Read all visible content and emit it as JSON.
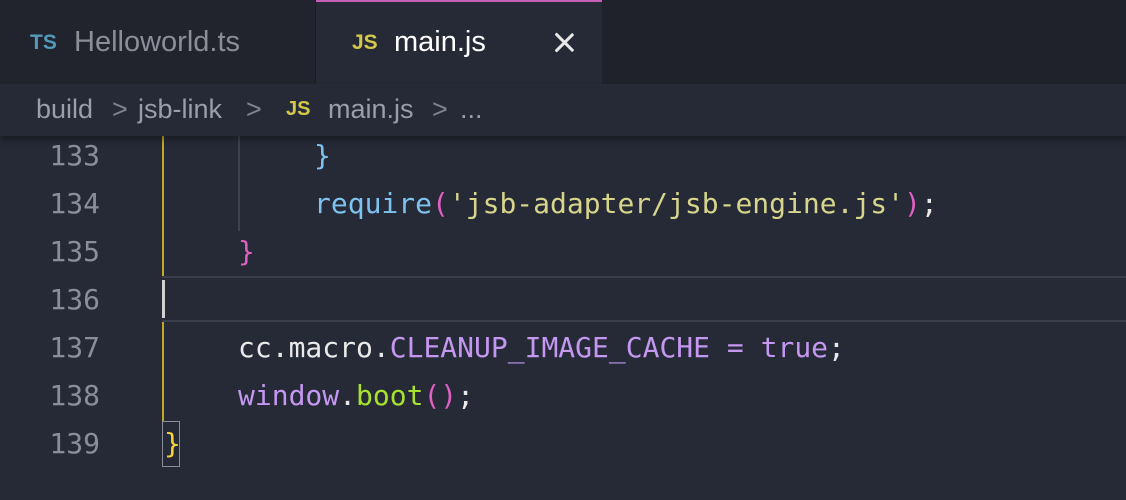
{
  "tabs": [
    {
      "icon": "TS",
      "label": "Helloworld.ts",
      "active": false
    },
    {
      "icon": "JS",
      "label": "main.js",
      "active": true
    }
  ],
  "breadcrumb": {
    "items": [
      "build",
      "jsb-link",
      "main.js",
      "..."
    ],
    "file_icon": "JS",
    "separator": ">"
  },
  "editor": {
    "line_numbers": [
      "133",
      "134",
      "135",
      "136",
      "137",
      "138",
      "139"
    ],
    "lines": {
      "l133": {
        "brace": "}"
      },
      "l134": {
        "func": "require",
        "open": "(",
        "str": "'jsb-adapter/jsb-engine.js'",
        "close": ")",
        "semi": ";"
      },
      "l135": {
        "brace": "}"
      },
      "l137": {
        "obj": "cc",
        "dot1": ".",
        "prop": "macro",
        "dot2": ".",
        "const": "CLEANUP_IMAGE_CACHE",
        "eq": " = ",
        "val": "true",
        "semi": ";"
      },
      "l138": {
        "obj": "window",
        "dot": ".",
        "func": "boot",
        "parens": "()",
        "semi": ";"
      },
      "l139": {
        "brace": "}"
      }
    }
  },
  "colors": {
    "background": "#262a36",
    "tab_active_border": "#c75eb8",
    "ts_icon": "#519aba",
    "js_icon": "#d4c84a"
  }
}
